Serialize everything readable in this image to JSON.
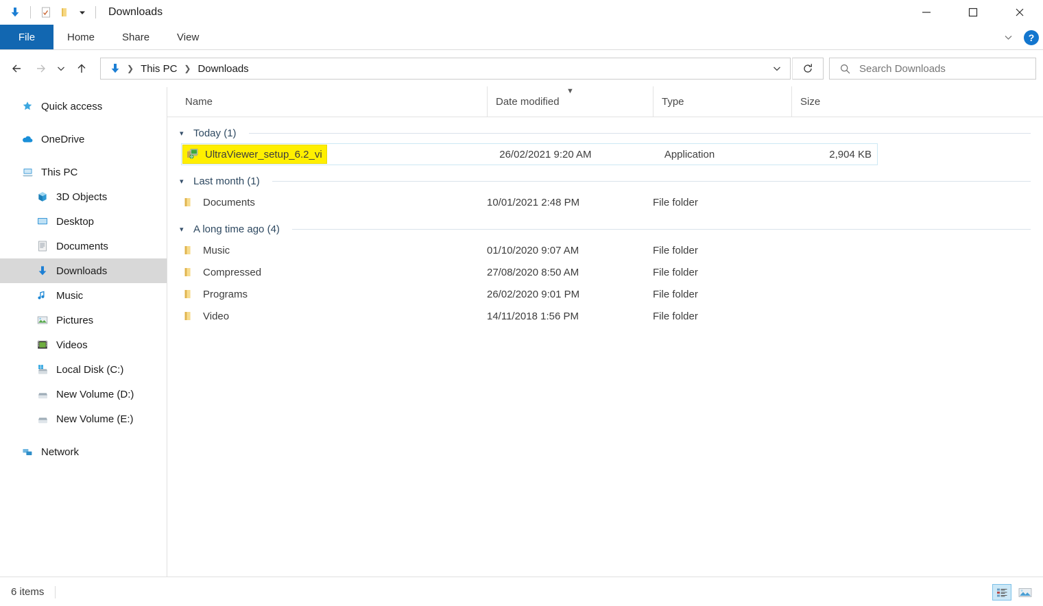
{
  "window": {
    "title": "Downloads",
    "accent_blue": "#1267b1",
    "highlight_yellow": "#ffef00",
    "selection_border": "#cce8f4",
    "quick_access": [
      {
        "name": "downloads-icon",
        "label": "Downloads"
      },
      {
        "name": "properties-icon",
        "label": "Properties"
      },
      {
        "name": "new-folder-icon",
        "label": "New folder"
      },
      {
        "name": "customize-chevron-icon",
        "label": "Customize Quick Access Toolbar"
      }
    ],
    "controls": [
      {
        "name": "minimize-button",
        "label": "Minimize"
      },
      {
        "name": "maximize-button",
        "label": "Maximize"
      },
      {
        "name": "close-button",
        "label": "Close"
      }
    ]
  },
  "ribbon": {
    "file_tab": "File",
    "tabs": [
      {
        "label": "Home"
      },
      {
        "label": "Share"
      },
      {
        "label": "View"
      }
    ],
    "collapse_label": "Minimize the Ribbon",
    "help_label": "?"
  },
  "navbar": {
    "back_label": "Back",
    "forward_label": "Forward",
    "recent_label": "Recent locations",
    "up_label": "Up",
    "breadcrumbs": [
      {
        "label": "This PC"
      },
      {
        "label": "Downloads"
      }
    ],
    "address_dropdown_label": "Previous locations",
    "refresh_label": "Refresh",
    "search": {
      "placeholder": "Search Downloads",
      "value": ""
    }
  },
  "sidebar": {
    "items": [
      {
        "label": "Quick access",
        "icon": "star-icon",
        "level": 0
      },
      {
        "label": "OneDrive",
        "icon": "cloud-icon",
        "level": 0
      },
      {
        "label": "This PC",
        "icon": "this-pc-icon",
        "level": 0
      },
      {
        "label": "3D Objects",
        "icon": "3d-objects-icon",
        "level": 1
      },
      {
        "label": "Desktop",
        "icon": "desktop-icon",
        "level": 1
      },
      {
        "label": "Documents",
        "icon": "documents-icon",
        "level": 1
      },
      {
        "label": "Downloads",
        "icon": "downloads-icon",
        "level": 1,
        "selected": true
      },
      {
        "label": "Music",
        "icon": "music-icon",
        "level": 1
      },
      {
        "label": "Pictures",
        "icon": "pictures-icon",
        "level": 1
      },
      {
        "label": "Videos",
        "icon": "videos-icon",
        "level": 1
      },
      {
        "label": "Local Disk (C:)",
        "icon": "local-disk-icon",
        "level": 1
      },
      {
        "label": "New Volume (D:)",
        "icon": "drive-icon",
        "level": 1
      },
      {
        "label": "New Volume (E:)",
        "icon": "drive-icon",
        "level": 1
      },
      {
        "label": "Network",
        "icon": "network-icon",
        "level": 0
      }
    ]
  },
  "filelist": {
    "columns": [
      {
        "label": "Name",
        "sorted": false
      },
      {
        "label": "Date modified",
        "sorted": true
      },
      {
        "label": "Type",
        "sorted": false
      },
      {
        "label": "Size",
        "sorted": false
      }
    ],
    "groups": [
      {
        "label": "Today (1)",
        "rows": [
          {
            "name": "UltraViewer_setup_6.2_vi",
            "date": "26/02/2021 9:20 AM",
            "type": "Application",
            "size": "2,904 KB",
            "icon": "installer-icon",
            "selected": true,
            "highlighted": true
          }
        ]
      },
      {
        "label": "Last month (1)",
        "rows": [
          {
            "name": "Documents",
            "date": "10/01/2021 2:48 PM",
            "type": "File folder",
            "size": "",
            "icon": "folder-icon",
            "selected": false,
            "highlighted": false
          }
        ]
      },
      {
        "label": "A long time ago (4)",
        "rows": [
          {
            "name": "Music",
            "date": "01/10/2020 9:07 AM",
            "type": "File folder",
            "size": "",
            "icon": "folder-icon",
            "selected": false,
            "highlighted": false
          },
          {
            "name": "Compressed",
            "date": "27/08/2020 8:50 AM",
            "type": "File folder",
            "size": "",
            "icon": "folder-icon",
            "selected": false,
            "highlighted": false
          },
          {
            "name": "Programs",
            "date": "26/02/2020 9:01 PM",
            "type": "File folder",
            "size": "",
            "icon": "folder-icon",
            "selected": false,
            "highlighted": false
          },
          {
            "name": "Video",
            "date": "14/11/2018 1:56 PM",
            "type": "File folder",
            "size": "",
            "icon": "folder-icon",
            "selected": false,
            "highlighted": false
          }
        ]
      }
    ]
  },
  "statusbar": {
    "item_count": "6 items",
    "views": [
      {
        "name": "details-view-button",
        "label": "Details view",
        "active": true
      },
      {
        "name": "large-icons-view-button",
        "label": "Large icons view",
        "active": false
      }
    ]
  }
}
